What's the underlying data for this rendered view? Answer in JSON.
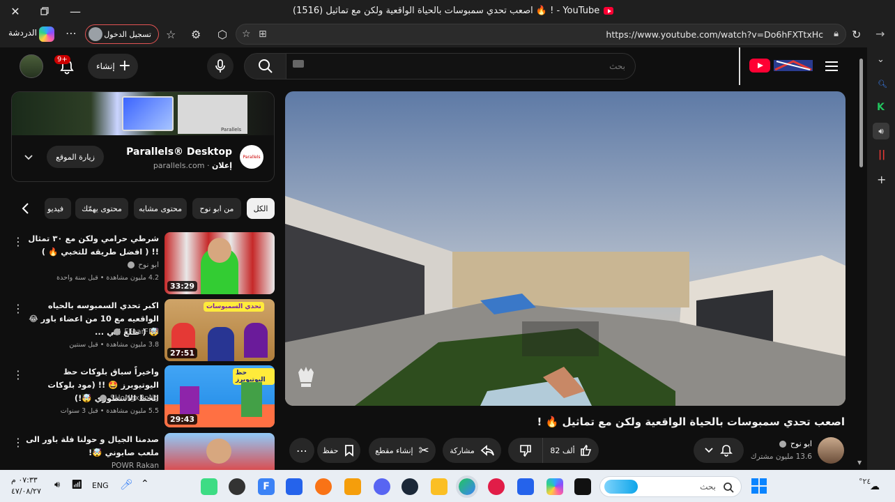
{
  "window": {
    "tab_title": "(1516) اصعب تحدي سمبوسات بالحياة الواقعية ولكن مع تماثيل 🔥 ! - YouTube"
  },
  "toolbar": {
    "chat_label": "الدردشة",
    "signin_label": "تسجيل الدخول",
    "url": "https://www.youtube.com/watch?v=Do6hFXTtxHc"
  },
  "masthead": {
    "notif_count": "9+",
    "create_label": "إنشاء",
    "search_placeholder": "بحث"
  },
  "ad": {
    "title": "Parallels® Desktop",
    "sub_label": "إعلان",
    "domain": "parallels.com",
    "visit_label": "زيارة الموقع",
    "banner_brand": "Parallels",
    "logo_text": "Parallels"
  },
  "chips": [
    "الكل",
    "من ابو نوح",
    "محتوى مشابه",
    "محتوى يهمّك",
    "فيديو"
  ],
  "recommendations": [
    {
      "title": "شرطي حرامي ولكن مع ٣٠ تمثال !! ( افضل طريقه للتخبي 🔥 )",
      "channel": "ابو نوح",
      "meta": "4.2 مليون مشاهدة • قبل سنة واحدة",
      "duration": "33:29"
    },
    {
      "title": "اكبر تحدي السمبوسه بالحياه الواقعيه مع 10 من اعضاء باور 😂🤯 ( طلع الي ...",
      "channel": "FFearFFul",
      "meta": "3.8 مليون مشاهدة • قبل سنتين",
      "duration": "27:51",
      "thumb_text": "تحدي السمبوسات"
    },
    {
      "title": "واخيراً سباق بلوكات حظ اليوتيوبرز 🤩 !! (مود بلوكات الحظ الاسطوري 🤯!)",
      "channel": "SHoNgxBoNg",
      "meta": "5.5 مليون مشاهدة • قبل 3 سنوات",
      "duration": "29:43",
      "thumb_text": "حظ اليوتيوبرز"
    },
    {
      "title": "صدمنا الجيال و حولنا فلة باور الى ملعب صابوني 🤯!",
      "channel": "POWR Rakan",
      "meta": "",
      "duration": ""
    }
  ],
  "video": {
    "title": "اصعب تحدي سمبوسات بالحياة الواقعية ولكن مع تماثيل 🔥 !",
    "channel": "ابو نوح",
    "subscribers": "13.6 مليون مشترك",
    "like_count": "82 ألف",
    "share_label": "مشاركة",
    "clip_label": "إنشاء مقطع",
    "save_label": "حفظ"
  },
  "taskbar": {
    "time": "٠٧:٣٣ م",
    "date": "٤٧/٠٨/٢٧",
    "lang": "ENG",
    "search_placeholder": "بحث",
    "weather": "°٢٤"
  },
  "colors": {
    "brand_red": "#ff0033",
    "page_bg": "#0f0f0f",
    "chip_bg": "#272727",
    "taskbar_bg": "#e9eef4"
  }
}
